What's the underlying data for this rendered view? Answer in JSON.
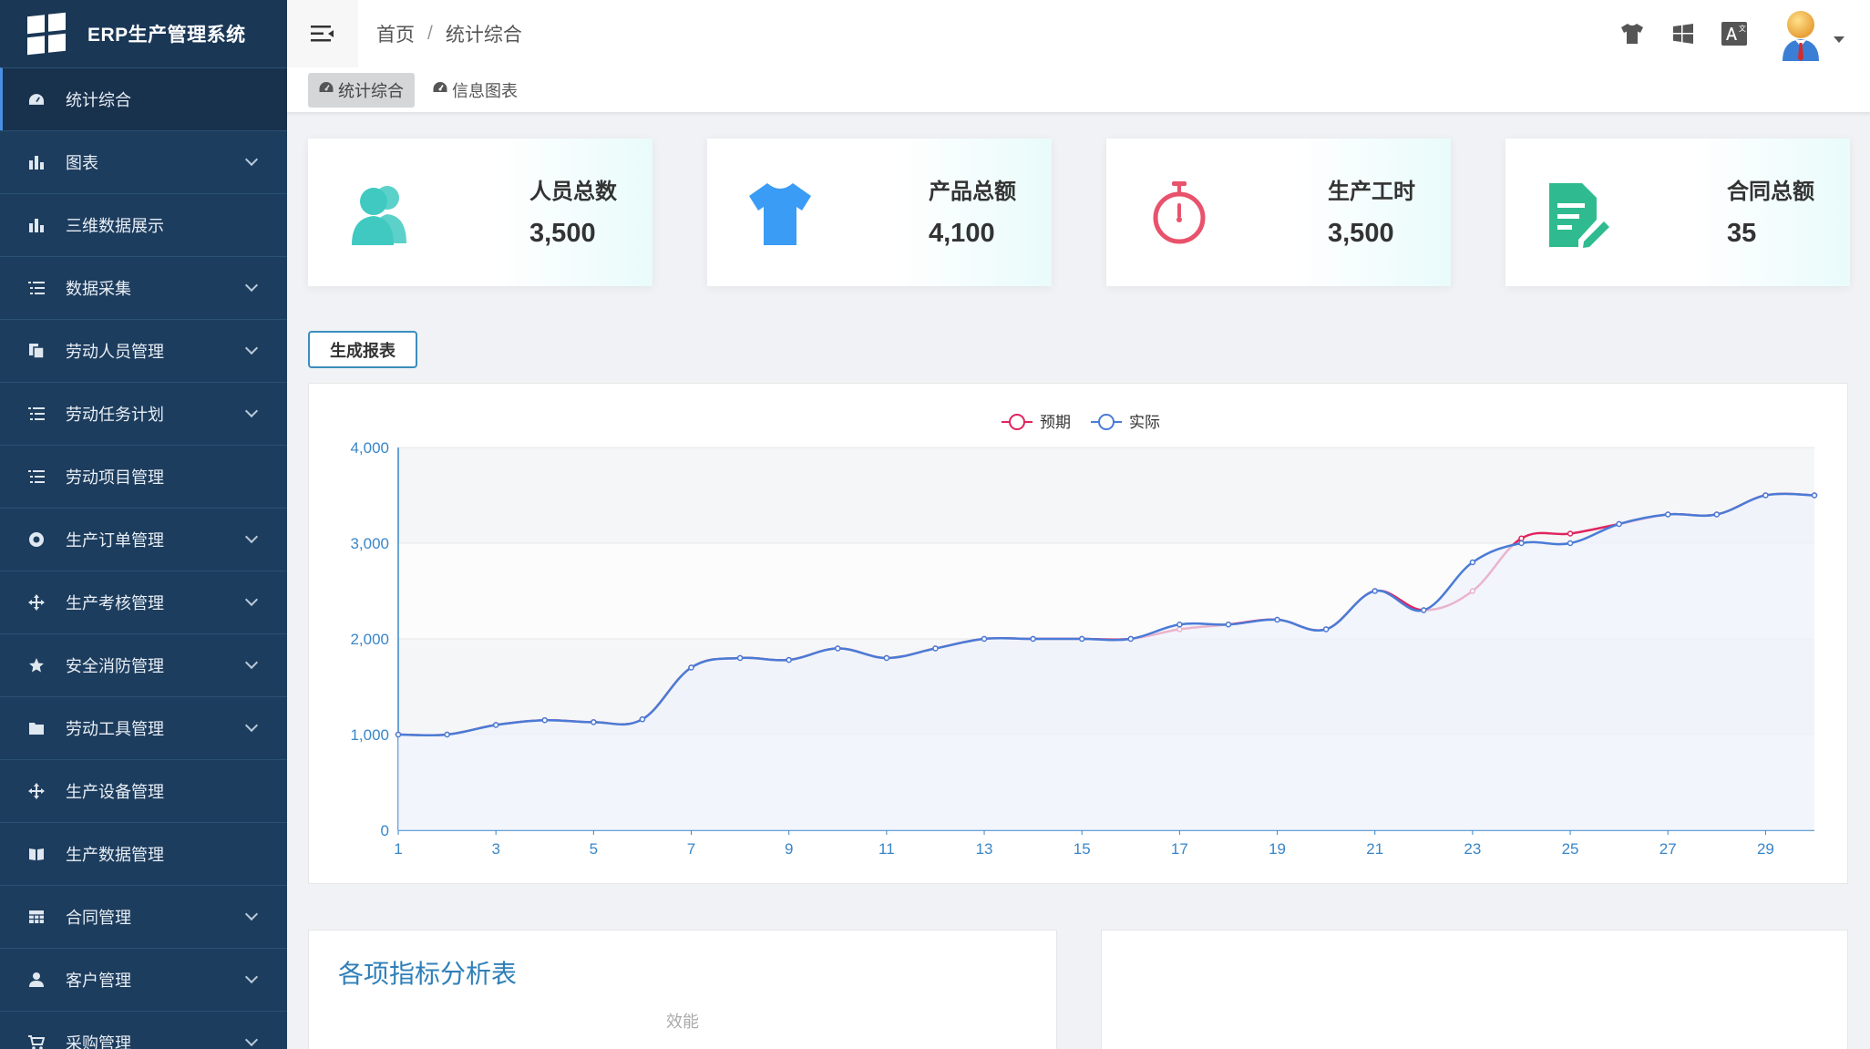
{
  "sidebar": {
    "brand_title": "ERP生产管理系统",
    "items": [
      {
        "label": "统计综合",
        "icon": "dashboard-icon",
        "has_children": false,
        "active": true
      },
      {
        "label": "图表",
        "icon": "bar-chart-icon",
        "has_children": true
      },
      {
        "label": "三维数据展示",
        "icon": "bar-chart-icon",
        "has_children": false
      },
      {
        "label": "数据采集",
        "icon": "list-icon",
        "has_children": true
      },
      {
        "label": "劳动人员管理",
        "icon": "copy-icon",
        "has_children": true
      },
      {
        "label": "劳动任务计划",
        "icon": "list-icon",
        "has_children": true
      },
      {
        "label": "劳动项目管理",
        "icon": "list-icon",
        "has_children": false
      },
      {
        "label": "生产订单管理",
        "icon": "lifebuoy-icon",
        "has_children": true
      },
      {
        "label": "生产考核管理",
        "icon": "move-icon",
        "has_children": true
      },
      {
        "label": "安全消防管理",
        "icon": "star-icon",
        "has_children": true
      },
      {
        "label": "劳动工具管理",
        "icon": "folder-icon",
        "has_children": true
      },
      {
        "label": "生产设备管理",
        "icon": "move-icon",
        "has_children": false
      },
      {
        "label": "生产数据管理",
        "icon": "book-icon",
        "has_children": false
      },
      {
        "label": "合同管理",
        "icon": "table-icon",
        "has_children": true
      },
      {
        "label": "客户管理",
        "icon": "user-icon",
        "has_children": true
      },
      {
        "label": "采购管理",
        "icon": "cart-icon",
        "has_children": true
      }
    ]
  },
  "header": {
    "breadcrumb": [
      "首页",
      "统计综合"
    ],
    "breadcrumb_sep": "/",
    "icons": [
      "shirt-icon",
      "windows-icon",
      "translate-icon"
    ]
  },
  "tabs": [
    {
      "label": "统计综合",
      "icon": "dashboard-icon",
      "active": true
    },
    {
      "label": "信息图表",
      "icon": "dashboard-icon",
      "active": false
    }
  ],
  "cards": [
    {
      "title": "人员总数",
      "value": "3,500",
      "icon": "users-icon",
      "color": "#3fc9c1"
    },
    {
      "title": "产品总额",
      "value": "4,100",
      "icon": "shirt-icon",
      "color": "#3a9cf5"
    },
    {
      "title": "生产工时",
      "value": "3,500",
      "icon": "stopwatch-icon",
      "color": "#e8526b"
    },
    {
      "title": "合同总额",
      "value": "35",
      "icon": "edit-document-icon",
      "color": "#2fbb8f"
    }
  ],
  "report_button_label": "生成报表",
  "chart_data": {
    "type": "line",
    "x": [
      1,
      2,
      3,
      4,
      5,
      6,
      7,
      8,
      9,
      10,
      11,
      12,
      13,
      14,
      15,
      16,
      17,
      18,
      19,
      20,
      21,
      22,
      23,
      24,
      25,
      26,
      27,
      28,
      29,
      30
    ],
    "x_tick_labels": [
      "1",
      "3",
      "5",
      "7",
      "9",
      "11",
      "13",
      "15",
      "17",
      "19",
      "21",
      "23",
      "25",
      "27",
      "29"
    ],
    "ylim": [
      0,
      4000
    ],
    "y_tick_labels": [
      "0",
      "1,000",
      "2,000",
      "3,000",
      "4,000"
    ],
    "grid": true,
    "legend_position": "top-center",
    "series": [
      {
        "name": "预期",
        "color": "#e0245e",
        "values": [
          1000,
          1000,
          1100,
          1150,
          1130,
          1160,
          1700,
          1800,
          1780,
          1900,
          1800,
          1900,
          2000,
          2000,
          2000,
          2000,
          2100,
          2150,
          2200,
          2100,
          2500,
          2300,
          2500,
          3050,
          3100,
          3200,
          3300,
          3300,
          3500,
          3500
        ]
      },
      {
        "name": "实际",
        "color": "#4a7bd6",
        "values": [
          1000,
          1000,
          1100,
          1150,
          1130,
          1160,
          1700,
          1800,
          1780,
          1900,
          1800,
          1900,
          2000,
          2000,
          2000,
          2000,
          2150,
          2150,
          2200,
          2100,
          2500,
          2300,
          2800,
          3000,
          3000,
          3200,
          3300,
          3300,
          3500,
          3500
        ]
      }
    ]
  },
  "bottom_left": {
    "title": "各项指标分析表",
    "radar_indicator": "效能"
  }
}
